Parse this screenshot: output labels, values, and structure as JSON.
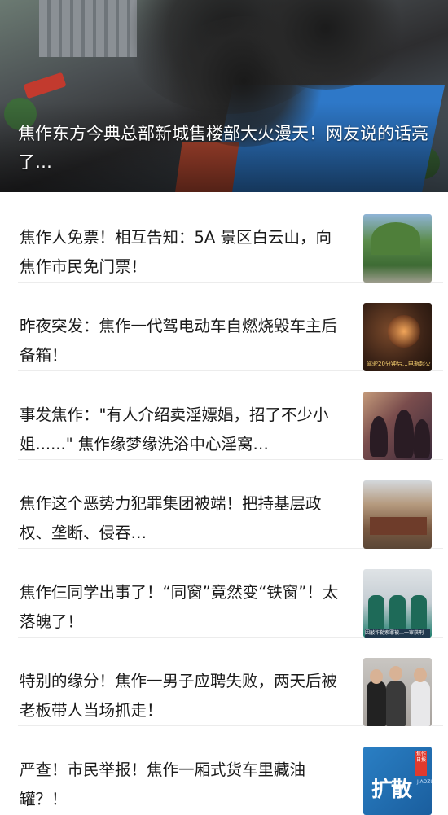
{
  "hero": {
    "title": "焦作东方今典总部新城售楼部大火漫天！网友说的话亮了…"
  },
  "articles": [
    {
      "title": "焦作人免票！相互告知：5A 景区白云山，向焦作市民免门票！",
      "thumb": "mountain-scenery-image"
    },
    {
      "title": "昨夜突发：焦作一代驾电动车自燃烧毁车主后备箱！",
      "thumb": "burning-scooter-image",
      "thumb_caption": "驾驶20分钟后…电瓶起火"
    },
    {
      "title": "事发焦作：\"有人介绍卖淫嫖娼，招了不少小姐......\"  焦作缘梦缘洗浴中心淫窝…",
      "thumb": "raid-scene-image"
    },
    {
      "title": "焦作这个恶势力犯罪集团被端！把持基层政权、垄断、侵吞…",
      "thumb": "courtroom-image"
    },
    {
      "title": "焦作仨同学出事了！“同窗”竟然变“铁窗”！太落魄了！",
      "thumb": "detainees-image",
      "thumb_caption": "因敲诈勒索罪被…一审获刑"
    },
    {
      "title": "特别的缘分！焦作一男子应聘失败，两天后被老板带人当场抓走！",
      "thumb": "police-arrest-image"
    },
    {
      "title": "严查！市民举报！焦作一厢式货车里藏油罐？！",
      "thumb": "share-banner-image",
      "thumb_big": "扩散",
      "thumb_tag": "焦作日报",
      "thumb_vert": "JIAOZUO"
    }
  ]
}
